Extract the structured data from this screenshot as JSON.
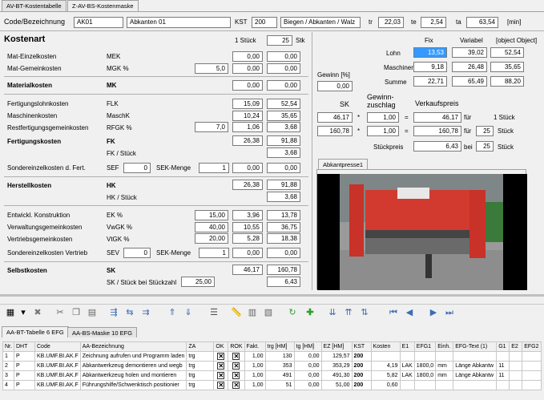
{
  "tabs": {
    "t1": "AV-BT-Kostentabelle",
    "t2": "Z-AV-BS-Kostenmaske"
  },
  "header": {
    "code_label": "Code/Bezeichnung",
    "code": "AK01",
    "name": "Abkanten 01",
    "kst_label": "KST",
    "kst": "200",
    "desc": "Biegen / Abkanten / Walz",
    "tr_label": "tr",
    "tr": "22,03",
    "te_label": "te",
    "te": "2,54",
    "ta_label": "ta",
    "ta": "63,54",
    "unit": "[min]"
  },
  "kostenart": {
    "title": "Kostenart",
    "stueck1": "1 Stück",
    "qty": "25",
    "stk": "Stk",
    "rows": {
      "mek": {
        "label": "Mat-Einzelkosten",
        "code": "MEK",
        "v1": "0,00",
        "v2": "0,00"
      },
      "mgk": {
        "label": "Mat-Gemeinkosten",
        "code": "MGK %",
        "pct": "5,0",
        "v1": "0,00",
        "v2": "0,00"
      },
      "mk": {
        "label": "Materialkosten",
        "code": "MK",
        "v1": "0,00",
        "v2": "0,00"
      },
      "flk": {
        "label": "Fertigungslohnkosten",
        "code": "FLK",
        "v1": "15,09",
        "v2": "52,54"
      },
      "maschk": {
        "label": "Maschinenkosten",
        "code": "MaschK",
        "v1": "10,24",
        "v2": "35,65"
      },
      "rfgk": {
        "label": "Restfertigungsgemeinkosten",
        "code": "RFGK %",
        "pct": "7,0",
        "v1": "1,06",
        "v2": "3,68"
      },
      "fk": {
        "label": "Fertigungskosten",
        "code": "FK",
        "v1": "26,38",
        "v2": "91,88"
      },
      "fkst": {
        "code": "FK / Stück",
        "v2": "3,68"
      },
      "sef": {
        "label": "Sondereinzelkosten d. Fert.",
        "code": "SEF",
        "sef": "0",
        "menge_label": "SEK-Menge",
        "menge": "1",
        "v1": "0,00",
        "v2": "0,00"
      },
      "hk": {
        "label": "Herstellkosten",
        "code": "HK",
        "v1": "26,38",
        "v2": "91,88"
      },
      "hkst": {
        "code": "HK / Stück",
        "v2": "3,68"
      },
      "ek": {
        "label": "Entwickl. Konstruktion",
        "code": "EK %",
        "pct": "15,00",
        "v1": "3,96",
        "v2": "13,78"
      },
      "vwgk": {
        "label": "Verwaltungsgemeinkosten",
        "code": "VwGK %",
        "pct": "40,00",
        "v1": "10,55",
        "v2": "36,75"
      },
      "vtgk": {
        "label": "Vertriebsgemeinkosten",
        "code": "VtGK %",
        "pct": "20,00",
        "v1": "5,28",
        "v2": "18,38"
      },
      "sev": {
        "label": "Sondereinzelkosten Vertrieb",
        "code": "SEV",
        "sev": "0",
        "menge_label": "SEK-Menge",
        "menge": "1",
        "v1": "0,00",
        "v2": "0,00"
      },
      "sk": {
        "label": "Selbstkosten",
        "code": "SK",
        "v1": "46,17",
        "v2": "160,78"
      },
      "skst": {
        "code": "SK / Stück bei Stückzahl",
        "qty": "25,00",
        "v2": "6,43"
      }
    }
  },
  "right": {
    "fix": "Fix",
    "variabel": "Variabel",
    "summe": {
      "label": "Summe",
      "fix": "22,71",
      "var": "65,49",
      "sum": "88,20"
    },
    "lohn": {
      "label": "Lohn",
      "fix": "13,53",
      "var": "39,02",
      "sum": "52,54"
    },
    "maschinen": {
      "label": "Maschinen",
      "fix": "9,18",
      "var": "26,48",
      "sum": "35,65"
    },
    "gewinn_label": "Gewinn [%]",
    "gewinn": "0,00",
    "sk_label": "SK",
    "gz_label1": "Gewinn-",
    "gz_label2": "zuschlag",
    "vk_label": "Verkaufspreis",
    "r1": {
      "sk": "46,17",
      "z": "1,00",
      "vk": "46,17",
      "fuer": "für",
      "stk": "1 Stück"
    },
    "r2": {
      "sk": "160,78",
      "z": "1,00",
      "vk": "160,78",
      "fuer": "für",
      "qty": "25",
      "stk": "Stück"
    },
    "stueckpreis": {
      "label": "Stückpreis",
      "val": "6,43",
      "bei": "bei",
      "qty": "25",
      "stk": "Stück"
    },
    "image_tab": "Abkantpresse1"
  },
  "bottom": {
    "tab1": "AA-BT-Tabelle 6 EFG",
    "tab2": "AA-BS-Maske 10 EFG",
    "columns": [
      "Nr.",
      "DHT",
      "Code",
      "AA-Bezeichnung",
      "ZA",
      "OK",
      "ROK",
      "Fakt.",
      "trg [HM]",
      "tg [HM]",
      "EZ [HM]",
      "KST",
      "Kosten",
      "E1",
      "EFG1",
      "Einh.",
      "EFG-Text (1)",
      "G1",
      "E2",
      "EFG2"
    ],
    "rows": [
      [
        "1",
        "P",
        "KB.UMF.BI.AK.F",
        "Zeichnung aufrufen und Programm laden",
        "trg",
        "",
        "",
        "1,00",
        "130",
        "0,00",
        "129,57",
        "200",
        "",
        "",
        "",
        "",
        "",
        "",
        "",
        ""
      ],
      [
        "2",
        "P",
        "KB.UMF.BI.AK.F",
        "Abkantwerkzeug demontieren und wegb",
        "trg",
        "",
        "",
        "1,00",
        "353",
        "0,00",
        "353,29",
        "200",
        "4,19",
        "LAK",
        "1800,0",
        "mm",
        "Länge Abkantw",
        "11",
        "",
        ""
      ],
      [
        "3",
        "P",
        "KB.UMF.BI.AK.F",
        "Abkantwerkzeug holen und montieren",
        "trg",
        "",
        "",
        "1,00",
        "491",
        "0,00",
        "491,30",
        "200",
        "5,82",
        "LAK",
        "1800,0",
        "mm",
        "Länge Abkantw",
        "11",
        "",
        ""
      ],
      [
        "4",
        "P",
        "KB.UMF.BI.AK.F",
        "Führungshilfe/Schwenktisch positionier",
        "trg",
        "",
        "",
        "1,00",
        "51",
        "0,00",
        "51,00",
        "200",
        "0,60",
        "",
        "",
        "",
        "",
        "",
        "",
        ""
      ]
    ]
  }
}
